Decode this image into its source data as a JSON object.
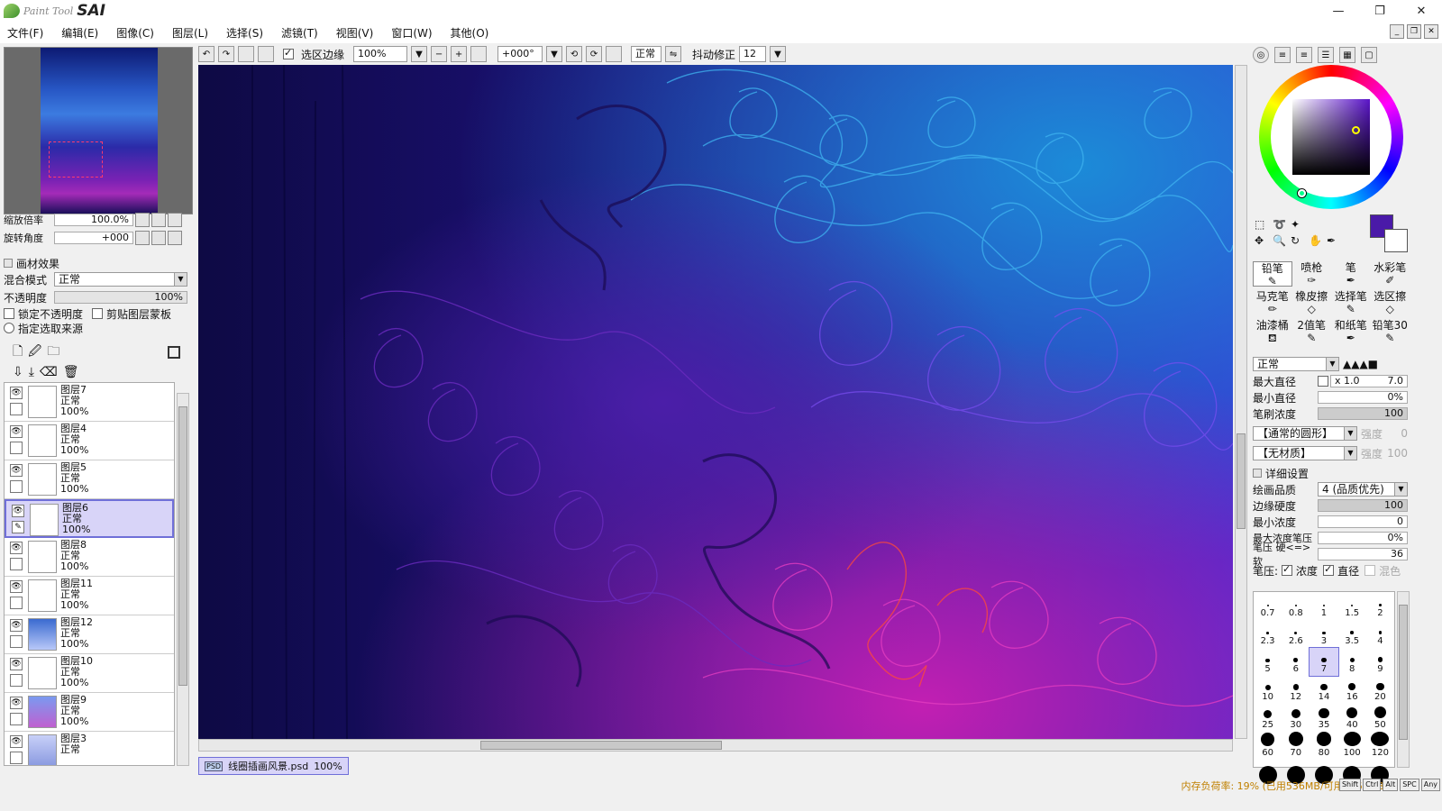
{
  "app": {
    "brand_small": "Paint Tool",
    "brand_big": "SAI"
  },
  "window_controls": {
    "minimize": "—",
    "maximize": "❐",
    "close": "✕"
  },
  "menu": [
    "文件(F)",
    "编辑(E)",
    "图像(C)",
    "图层(L)",
    "选择(S)",
    "滤镜(T)",
    "视图(V)",
    "窗口(W)",
    "其他(O)"
  ],
  "navigator": {
    "zoom_label": "缩放倍率",
    "zoom_value": "100.0%",
    "rotate_label": "旋转角度",
    "rotate_value": "+000"
  },
  "layer_props": {
    "effect_label": "画材效果",
    "blend_label": "混合模式",
    "blend_value": "正常",
    "opacity_label": "不透明度",
    "opacity_value": "100%",
    "lock_opacity": "锁定不透明度",
    "clip_group": "剪贴图层蒙板",
    "selection_source": "指定选取来源"
  },
  "layers": [
    {
      "name": "图层7",
      "mode": "正常",
      "opacity": "100%",
      "selected": false
    },
    {
      "name": "图层4",
      "mode": "正常",
      "opacity": "100%",
      "selected": false
    },
    {
      "name": "图层5",
      "mode": "正常",
      "opacity": "100%",
      "selected": false
    },
    {
      "name": "图层6",
      "mode": "正常",
      "opacity": "100%",
      "selected": true
    },
    {
      "name": "图层8",
      "mode": "正常",
      "opacity": "100%",
      "selected": false
    },
    {
      "name": "图层11",
      "mode": "正常",
      "opacity": "100%",
      "selected": false
    },
    {
      "name": "图层12",
      "mode": "正常",
      "opacity": "100%",
      "selected": false
    },
    {
      "name": "图层10",
      "mode": "正常",
      "opacity": "100%",
      "selected": false
    },
    {
      "name": "图层9",
      "mode": "正常",
      "opacity": "100%",
      "selected": false
    },
    {
      "name": "图层3",
      "mode": "正常",
      "opacity": "",
      "selected": false
    }
  ],
  "toolbar": {
    "selection_edge": "选区边缘",
    "zoom": "100%",
    "angle": "+000°",
    "mode": "正常",
    "stabilizer_label": "抖动修正",
    "stabilizer_value": "12"
  },
  "document_tab": {
    "name": "线圈插画风景.psd",
    "zoom": "100%"
  },
  "colors": {
    "primary": "#4a1aa8",
    "secondary": "#ffffff",
    "canvas_bg": "#1a0f6a"
  },
  "tools": [
    {
      "label": "铅笔",
      "selected": true
    },
    {
      "label": "喷枪",
      "selected": false
    },
    {
      "label": "笔",
      "selected": false
    },
    {
      "label": "水彩笔",
      "selected": false
    },
    {
      "label": "马克笔",
      "selected": false
    },
    {
      "label": "橡皮擦",
      "selected": false
    },
    {
      "label": "选择笔",
      "selected": false
    },
    {
      "label": "选区擦",
      "selected": false
    },
    {
      "label": "油漆桶",
      "selected": false
    },
    {
      "label": "2值笔",
      "selected": false
    },
    {
      "label": "和纸笔",
      "selected": false
    },
    {
      "label": "铅笔30",
      "selected": false
    }
  ],
  "brush": {
    "mode": "正常",
    "max_size_label": "最大直径",
    "max_size_mult": "x 1.0",
    "max_size_value": "7.0",
    "min_size_label": "最小直径",
    "min_size_value": "0%",
    "density_label": "笔刷浓度",
    "density_value": "100",
    "shape": "【通常的圆形】",
    "shape_intensity_label": "强度",
    "shape_intensity_value": "0",
    "texture": "【无材质】",
    "texture_intensity_label": "强度",
    "texture_intensity_value": "100",
    "detail_label": "详细设置",
    "quality_label": "绘画品质",
    "quality_value": "4 (品质优先)",
    "edge_label": "边缘硬度",
    "edge_value": "100",
    "min_density_label": "最小浓度",
    "min_density_value": "0",
    "max_density_pressure_label": "最大浓度笔压",
    "max_density_pressure_value": "0%",
    "pressure_label": "笔压 硬<=>软",
    "pressure_value": "36",
    "pressure_opts_label": "笔压:",
    "opt_density": "浓度",
    "opt_size": "直径",
    "opt_blend": "混色"
  },
  "brush_sizes": [
    "0.7",
    "0.8",
    "1",
    "1.5",
    "2",
    "2.3",
    "2.6",
    "3",
    "3.5",
    "4",
    "5",
    "6",
    "7",
    "8",
    "9",
    "10",
    "12",
    "14",
    "16",
    "20",
    "25",
    "30",
    "35",
    "40",
    "50",
    "60",
    "70",
    "80",
    "100",
    "120",
    "",
    "",
    "",
    "",
    ""
  ],
  "brush_size_selected": "7",
  "status": {
    "memory": "内存负荷率: 19% (已用536MB/可用2061MB)"
  },
  "keys": [
    "Shift",
    "Ctrl",
    "Alt",
    "SPC",
    "Any"
  ]
}
